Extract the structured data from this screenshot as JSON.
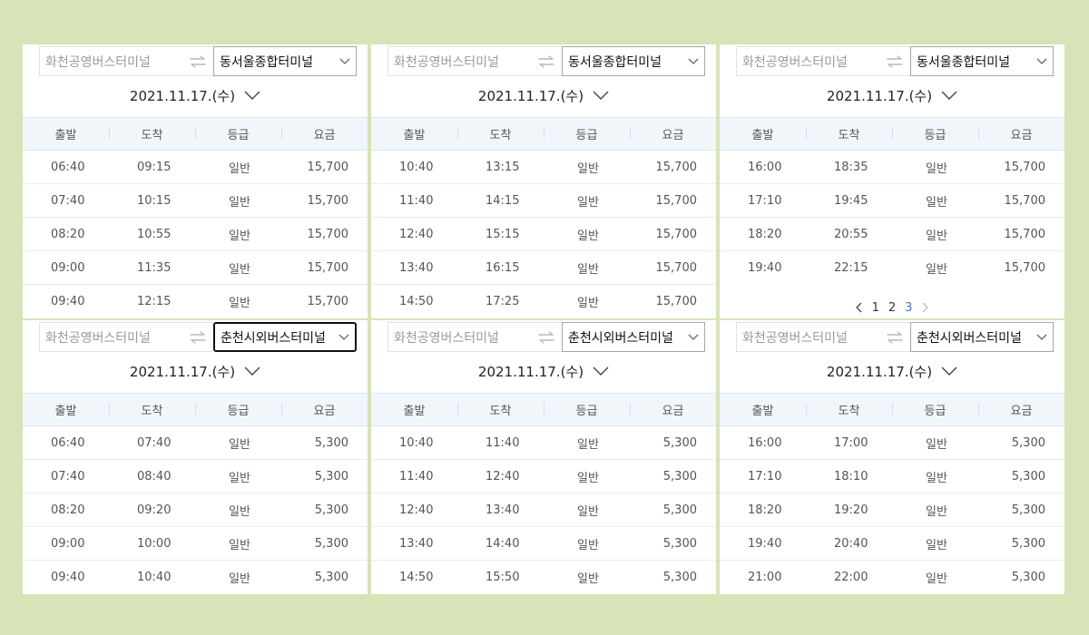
{
  "icons": {
    "swap": "swap-arrows-icon",
    "dropdown": "chevron-down-icon",
    "date_dropdown": "chevron-down-icon",
    "page_prev": "chevron-left-icon",
    "page_next": "chevron-right-icon"
  },
  "colors": {
    "page_background": "#d6e4b8",
    "panel_background": "#ffffff",
    "table_header_background": "#f1f6fb",
    "active_page": "#3a72c9"
  },
  "table_headers": [
    "출발",
    "도착",
    "등급",
    "요금"
  ],
  "panels": [
    {
      "origin": "화천공영버스터미널",
      "destination": "동서울종합터미널",
      "date": "2021.11.17.(수)",
      "rows": [
        [
          "06:40",
          "09:15",
          "일반",
          "15,700"
        ],
        [
          "07:40",
          "10:15",
          "일반",
          "15,700"
        ],
        [
          "08:20",
          "10:55",
          "일반",
          "15,700"
        ],
        [
          "09:00",
          "11:35",
          "일반",
          "15,700"
        ],
        [
          "09:40",
          "12:15",
          "일반",
          "15,700"
        ]
      ]
    },
    {
      "origin": "화천공영버스터미널",
      "destination": "동서울종합터미널",
      "date": "2021.11.17.(수)",
      "rows": [
        [
          "10:40",
          "13:15",
          "일반",
          "15,700"
        ],
        [
          "11:40",
          "14:15",
          "일반",
          "15,700"
        ],
        [
          "12:40",
          "15:15",
          "일반",
          "15,700"
        ],
        [
          "13:40",
          "16:15",
          "일반",
          "15,700"
        ],
        [
          "14:50",
          "17:25",
          "일반",
          "15,700"
        ]
      ]
    },
    {
      "origin": "화천공영버스터미널",
      "destination": "동서울종합터미널",
      "date": "2021.11.17.(수)",
      "rows": [
        [
          "16:00",
          "18:35",
          "일반",
          "15,700"
        ],
        [
          "17:10",
          "19:45",
          "일반",
          "15,700"
        ],
        [
          "18:20",
          "20:55",
          "일반",
          "15,700"
        ],
        [
          "19:40",
          "22:15",
          "일반",
          "15,700"
        ]
      ],
      "pagination": {
        "pages": [
          "1",
          "2",
          "3"
        ],
        "current": "3"
      }
    },
    {
      "origin": "화천공영버스터미널",
      "destination": "춘천시외버스터미널",
      "destination_focused": true,
      "date": "2021.11.17.(수)",
      "rows": [
        [
          "06:40",
          "07:40",
          "일반",
          "5,300"
        ],
        [
          "07:40",
          "08:40",
          "일반",
          "5,300"
        ],
        [
          "08:20",
          "09:20",
          "일반",
          "5,300"
        ],
        [
          "09:00",
          "10:00",
          "일반",
          "5,300"
        ],
        [
          "09:40",
          "10:40",
          "일반",
          "5,300"
        ]
      ]
    },
    {
      "origin": "화천공영버스터미널",
      "destination": "춘천시외버스터미널",
      "date": "2021.11.17.(수)",
      "rows": [
        [
          "10:40",
          "11:40",
          "일반",
          "5,300"
        ],
        [
          "11:40",
          "12:40",
          "일반",
          "5,300"
        ],
        [
          "12:40",
          "13:40",
          "일반",
          "5,300"
        ],
        [
          "13:40",
          "14:40",
          "일반",
          "5,300"
        ],
        [
          "14:50",
          "15:50",
          "일반",
          "5,300"
        ]
      ]
    },
    {
      "origin": "화천공영버스터미널",
      "destination": "춘천시외버스터미널",
      "date": "2021.11.17.(수)",
      "rows": [
        [
          "16:00",
          "17:00",
          "일반",
          "5,300"
        ],
        [
          "17:10",
          "18:10",
          "일반",
          "5,300"
        ],
        [
          "18:20",
          "19:20",
          "일반",
          "5,300"
        ],
        [
          "19:40",
          "20:40",
          "일반",
          "5,300"
        ],
        [
          "21:00",
          "22:00",
          "일반",
          "5,300"
        ]
      ]
    }
  ]
}
